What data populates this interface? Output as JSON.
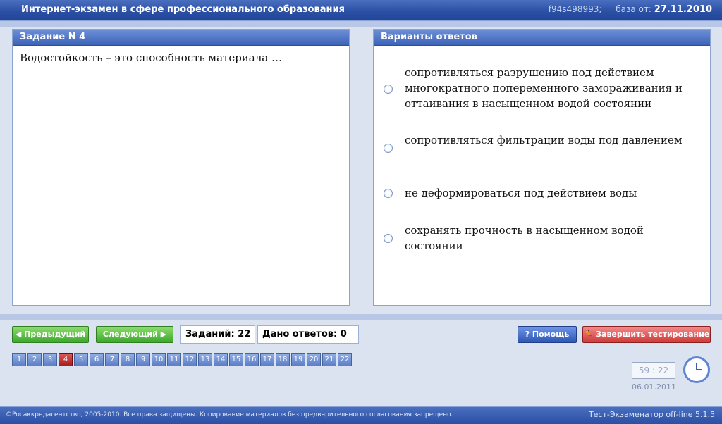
{
  "title": "Интернет-экзамен в сфере профессионального образования",
  "header_right": {
    "code": "f94s498993;",
    "base_label": "база от:",
    "base_date": "27.11.2010"
  },
  "question_panel": {
    "title": "Задание N 4",
    "question": "Водостойкость – это способность материала …"
  },
  "answers_panel": {
    "title": "Варианты ответов",
    "options": [
      "сопротивляться разрушению под действием многократного попеременного замораживания и оттаивания в насыщенном водой состоянии",
      "сопротивляться фильтрации воды под давлением",
      "не деформироваться под действием воды",
      "сохранять прочность в насыщенном водой состоянии"
    ]
  },
  "controls": {
    "prev": "Предыдущий",
    "next": "Следующий",
    "tasks": "Заданий: 22",
    "answered": "Дано ответов: 0",
    "help": "Помощь",
    "finish": "Завершить тестирование"
  },
  "navigation": {
    "items": [
      "1",
      "2",
      "3",
      "4",
      "5",
      "6",
      "7",
      "8",
      "9",
      "10",
      "11",
      "12",
      "13",
      "14",
      "15",
      "16",
      "17",
      "18",
      "19",
      "20",
      "21",
      "22"
    ],
    "active": "4"
  },
  "timer": "59 : 22",
  "date": "06.01.2011",
  "footer": {
    "left": "©Росаккредагентство, 2005-2010. Все права защищены. Копирование материалов без предварительного согласования запрещено.",
    "right": "Тест-Экзаменатор off-line 5.1.5"
  },
  "colors": {
    "accent": "#2a4fa3",
    "active": "#c62c2c",
    "green": "#3aa82c"
  }
}
